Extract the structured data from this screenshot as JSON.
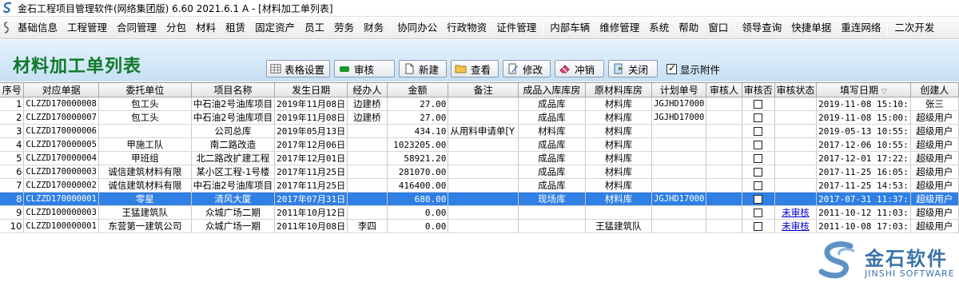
{
  "window": {
    "title": "金石工程项目管理软件(网络集团版) 6.60  2021.6.1 A - [材料加工单列表]"
  },
  "menubar": {
    "groups": [
      [
        "基础信息",
        "工程管理",
        "合同管理",
        "分包",
        "材料",
        "租赁",
        "固定资产",
        "员工",
        "劳务",
        "财务"
      ],
      [
        "协同办公",
        "行政物资",
        "证件管理"
      ],
      [
        "内部车辆",
        "维修管理",
        "系统",
        "帮助",
        "窗口"
      ],
      [
        "领导查询",
        "快捷单据",
        "重连网络"
      ],
      [
        "二次开发"
      ]
    ]
  },
  "page": {
    "title": "材料加工单列表"
  },
  "toolbar": {
    "buttons": [
      {
        "label": "表格设置",
        "icon": "grid-settings-icon"
      },
      {
        "label": "审核",
        "icon": "approve-icon"
      },
      {
        "label": "新建",
        "icon": "new-document-icon"
      },
      {
        "label": "查看",
        "icon": "folder-open-icon"
      },
      {
        "label": "修改",
        "icon": "edit-icon"
      },
      {
        "label": "冲销",
        "icon": "eraser-icon"
      },
      {
        "label": "关闭",
        "icon": "close-door-icon"
      }
    ],
    "show_attachment": {
      "label": "显示附件",
      "checked": true
    }
  },
  "table": {
    "columns": [
      "序号",
      "对应单据",
      "委托单位",
      "项目名称",
      "发生日期",
      "经办人",
      "金额",
      "备注",
      "成品入库库房",
      "原材料库房",
      "计划单号",
      "审核人",
      "审核否",
      "审核状态",
      "填写日期",
      "创建人"
    ],
    "selected_index": 7,
    "rows": [
      [
        "1",
        "CLZZD170000008",
        "包工头",
        "中石油2号油库项目",
        "2019年11月08日",
        "边建桥",
        "27.00",
        "",
        "成品库",
        "材料库",
        "JGJHD17000",
        "",
        "",
        "",
        "2019-11-08 15:10:",
        "张三"
      ],
      [
        "2",
        "CLZZD170000007",
        "包工头",
        "中石油2号油库项目",
        "2019年11月08日",
        "边建桥",
        "27.00",
        "",
        "成品库",
        "材料库",
        "JGJHD17000",
        "",
        "",
        "",
        "2019-11-08 15:00:",
        "超级用户"
      ],
      [
        "3",
        "CLZZD170000006",
        "",
        "公司总库",
        "2019年05月13日",
        "",
        "434.10",
        "从用料申请单[Y",
        "材料库",
        "材料库",
        "",
        "",
        "",
        "",
        "2019-05-13 10:55:",
        "超级用户"
      ],
      [
        "4",
        "CLZZD170000005",
        "甲施工队",
        "南二路改造",
        "2017年12月06日",
        "",
        "1023205.00",
        "",
        "成品库",
        "材料库",
        "",
        "",
        "",
        "",
        "2017-12-06 10:55:",
        "超级用户"
      ],
      [
        "5",
        "CLZZD170000004",
        "甲班组",
        "北二路改扩建工程",
        "2017年12月01日",
        "",
        "58921.20",
        "",
        "成品库",
        "材料库",
        "",
        "",
        "",
        "",
        "2017-12-01 17:22:",
        "超级用户"
      ],
      [
        "6",
        "CLZZD170000003",
        "诚信建筑材料有限",
        "某小区工程-1号楼",
        "2017年11月25日",
        "",
        "281070.00",
        "",
        "成品库",
        "材料库",
        "",
        "",
        "",
        "",
        "2017-11-25 16:05:",
        "超级用户"
      ],
      [
        "7",
        "CLZZD170000002",
        "诚信建筑材料有限",
        "中石油2号油库项目",
        "2017年11月25日",
        "",
        "416400.00",
        "",
        "成品库",
        "材料库",
        "",
        "",
        "",
        "",
        "2017-11-25 14:53:",
        "超级用户"
      ],
      [
        "8",
        "CLZZD170000001",
        "零星",
        "清风大厦",
        "2017年07月31日",
        "",
        "680.00",
        "",
        "现场库",
        "材料库",
        "JGJHD17000",
        "",
        "",
        "",
        "2017-07-31 11:37:",
        "超级用户"
      ],
      [
        "9",
        "CLZZD100000003",
        "王猛建筑队",
        "众城广场二期",
        "2011年10月12日",
        "",
        "0.00",
        "",
        "",
        "",
        "",
        "",
        "",
        "未审核",
        "2011-10-12 11:03:",
        "超级用户"
      ],
      [
        "10",
        "CLZZD100000001",
        "东营第一建筑公司",
        "众城广场一期",
        "2011年10月08日",
        "李四",
        "0.00",
        "",
        "",
        "王猛建筑队",
        "",
        "",
        "",
        "未审核",
        "2011-10-08 17:03:",
        "超级用户"
      ]
    ]
  },
  "watermark": {
    "cn": "金石软件",
    "en": "JINSHI SOFTWARE"
  }
}
